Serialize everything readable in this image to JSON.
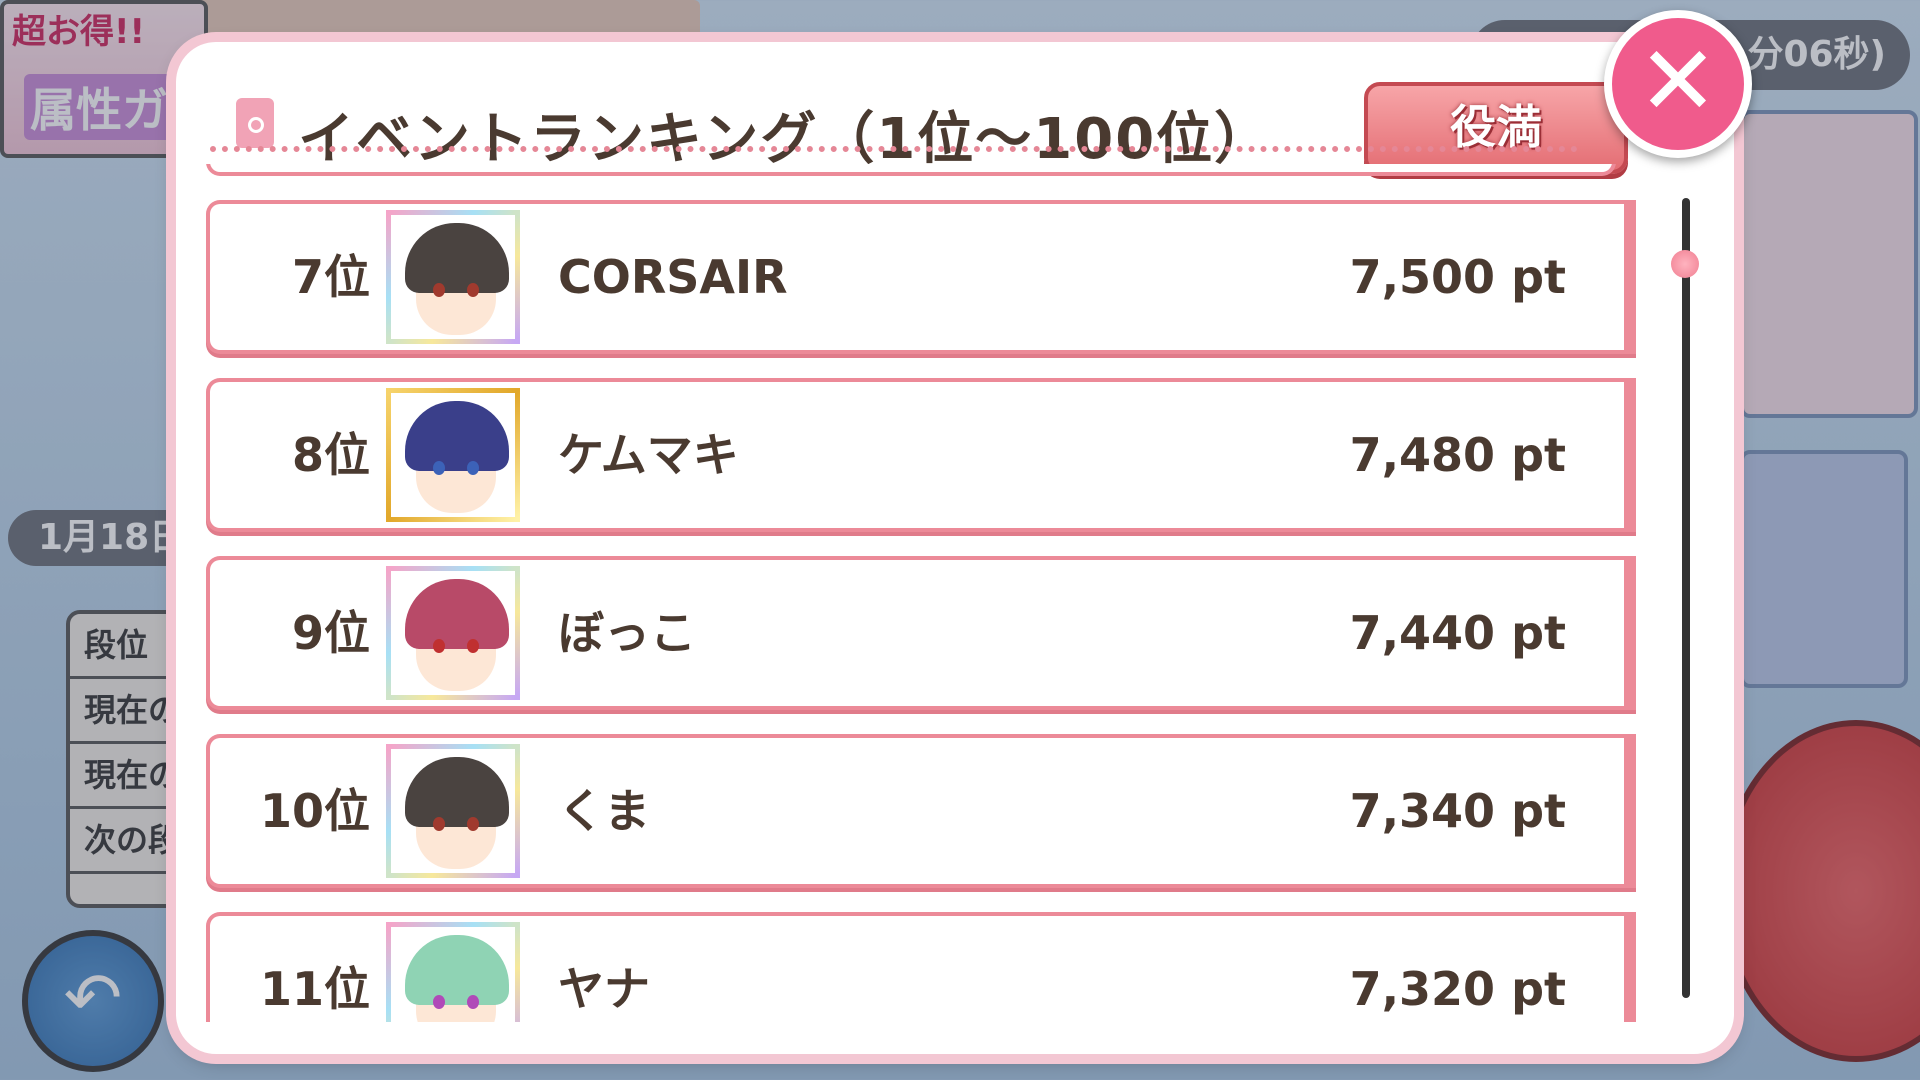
{
  "background": {
    "banner_left_line1": "超お得!!",
    "banner_left_line2": "属性ガ",
    "timer_text": "分06秒)",
    "date_text": "1月18日",
    "info_rows": [
      "段位",
      "現在の",
      "現在の",
      "次の段"
    ],
    "back_icon": "back-arrow-icon"
  },
  "modal": {
    "title": "イベントランキング（1位〜100位）",
    "role_button_label": "役満",
    "close_icon": "close-x-icon",
    "accent_color": "#ec8a98",
    "close_color": "#f05b8c"
  },
  "ranking": [
    {
      "rank": "7位",
      "name": "CORSAIR",
      "points": "7,500 pt",
      "frame": "rainbow"
    },
    {
      "rank": "8位",
      "name": "ケムマキ",
      "points": "7,480 pt",
      "frame": "gold"
    },
    {
      "rank": "9位",
      "name": "ぼっこ",
      "points": "7,440 pt",
      "frame": "rainbow"
    },
    {
      "rank": "10位",
      "name": "くま",
      "points": "7,340 pt",
      "frame": "rainbow"
    },
    {
      "rank": "11位",
      "name": "ヤナ",
      "points": "7,320 pt",
      "frame": "rainbow"
    }
  ]
}
